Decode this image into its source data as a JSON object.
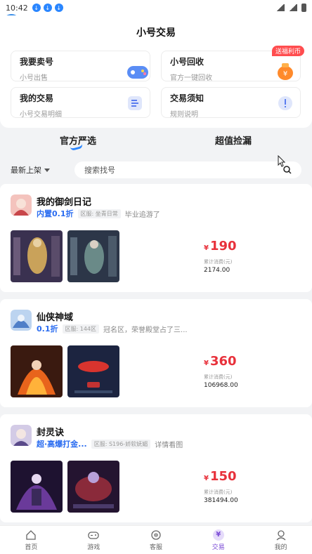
{
  "status_bar": {
    "time": "10:42"
  },
  "header": {
    "title": "小号交易"
  },
  "cards": {
    "sell": {
      "title": "我要卖号",
      "sub": "小号出售"
    },
    "recycle": {
      "title": "小号回收",
      "sub": "官方一键回收",
      "badge": "送福利币"
    },
    "my_trade": {
      "title": "我的交易",
      "sub": "小号交易明细"
    },
    "notice": {
      "title": "交易须知",
      "sub": "规则说明"
    }
  },
  "tabs": {
    "official": "官方严选",
    "bargain": "超值捡漏"
  },
  "filter": {
    "sort": "最新上架",
    "search_placeholder": "搜索找号"
  },
  "listings": [
    {
      "game": "我的御剑日记",
      "discount": "内置0.1折",
      "tag": "区服: 坐青日常",
      "desc": "毕业追游了",
      "price_symbol": "¥",
      "price": "190",
      "price_label": "累计消费(元)",
      "price_value": "2174.00"
    },
    {
      "game": "仙侠神域",
      "discount": "0.1折",
      "tag": "区服: 144区",
      "desc": "冠名区，荣誉殿堂占了三...",
      "price_symbol": "¥",
      "price": "360",
      "price_label": "累计消费(元)",
      "price_value": "106968.00"
    },
    {
      "game": "封灵诀",
      "discount": "超·高爆打金...",
      "tag": "区服: S196-娇软妩媚",
      "desc": "详情看图",
      "price_symbol": "¥",
      "price": "150",
      "price_label": "累计消费(元)",
      "price_value": "381494.00"
    }
  ],
  "tabbar": [
    {
      "label": "首页",
      "icon": "home-icon"
    },
    {
      "label": "游戏",
      "icon": "gamepad-icon"
    },
    {
      "label": "客服",
      "icon": "support-icon"
    },
    {
      "label": "交易",
      "icon": "trade-icon",
      "active": true
    },
    {
      "label": "我的",
      "icon": "profile-icon"
    }
  ],
  "colors": {
    "accent": "#2a86ff",
    "price": "#e8313b",
    "active_tab": "#7b4bd6"
  }
}
